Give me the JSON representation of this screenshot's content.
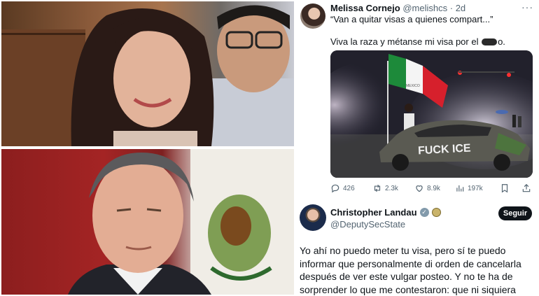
{
  "tweet1": {
    "author_name": "Melissa Cornejo",
    "handle": "@melishcs",
    "separator": "·",
    "time": "2d",
    "more_icon": "more-horizontal-icon",
    "quote_line": "“Van a quitar visas a quienes compart...”",
    "body_before_censor": "Viva la raza y métanse mi visa por el ",
    "body_after_censor": "o.",
    "media_sign_text": "FUCK ICE",
    "flag_text": "MEXICO",
    "stats": {
      "replies": "426",
      "retweets": "2.3k",
      "likes": "8.9k",
      "views": "197k"
    }
  },
  "tweet2": {
    "author_name": "Christopher Landau",
    "handle": "@DeputySecState",
    "follow_label": "Seguir",
    "body": "Yo ahí no puedo meter tu visa, pero sí te puedo informar que personalmente di orden de cancelarla después de ver este vulgar posteo. Y no te ha de sorprender lo que me contestaron: que ni siquiera"
  },
  "colors": {
    "text_primary": "#0f1419",
    "text_secondary": "#536471",
    "follow_bg": "#0f1419",
    "verified_badge": "#829aab"
  }
}
